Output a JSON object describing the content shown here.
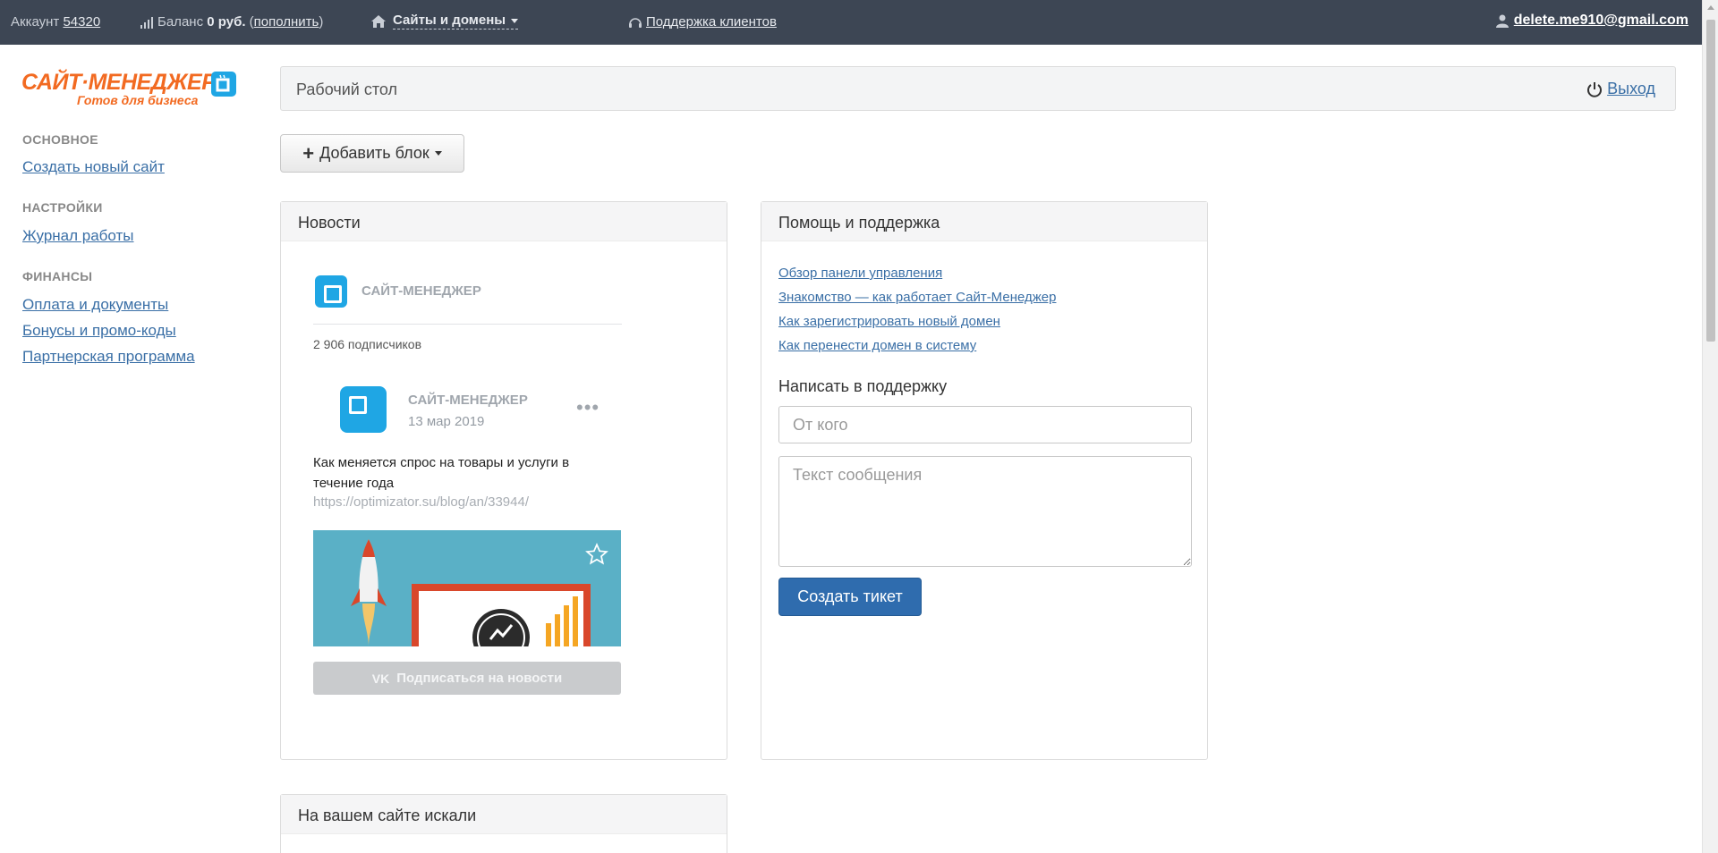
{
  "topbar": {
    "account_label": "Аккаунт",
    "account_id": "54320",
    "balance_label": "Баланс",
    "balance_value": "0 руб.",
    "topup_link": "пополнить",
    "sites_menu": "Сайты и домены",
    "support_link": "Поддержка клиентов",
    "user_email": "delete.me910@gmail.com"
  },
  "logo": {
    "name": "САЙТ·МЕНЕДЖЕР",
    "tagline": "Готов для бизнеса"
  },
  "sidebar": {
    "sections": [
      {
        "heading": "ОСНОВНОЕ",
        "links": [
          "Создать новый сайт"
        ]
      },
      {
        "heading": "НАСТРОЙКИ",
        "links": [
          "Журнал работы"
        ]
      },
      {
        "heading": "ФИНАНСЫ",
        "links": [
          "Оплата и документы",
          "Бонусы и промо-коды",
          "Партнерская программа"
        ]
      }
    ]
  },
  "header": {
    "title": "Рабочий стол",
    "logout": "Выход"
  },
  "add_block_button": "Добавить блок",
  "news": {
    "title": "Новости",
    "community_name": "САЙТ-МЕНЕДЖЕР",
    "subscribers": "2 906 подписчиков",
    "post_author": "САЙТ-МЕНЕДЖЕР",
    "post_date": "13 мар 2019",
    "post_text": "Как меняется спрос на товары и услуги в течение года",
    "post_url": "https://optimizator.su/blog/an/33944/",
    "subscribe_button": "Подписаться на новости"
  },
  "help": {
    "title": "Помощь и поддержка",
    "links": [
      "Обзор панели управления",
      "Знакомство — как работает Сайт-Менеджер",
      "Как зарегистрировать новый домен",
      "Как перенести домен в систему"
    ],
    "write_title": "Написать в поддержку",
    "from_placeholder": "От кого",
    "message_placeholder": "Текст сообщения",
    "submit_button": "Создать тикет"
  },
  "search_panel": {
    "title": "На вашем сайте искали"
  },
  "colors": {
    "topbar": "#3d4654",
    "brand_orange": "#f26a21",
    "brand_blue": "#1fa6e4",
    "link": "#3a6fa6",
    "primary_button": "#2f6cae"
  }
}
